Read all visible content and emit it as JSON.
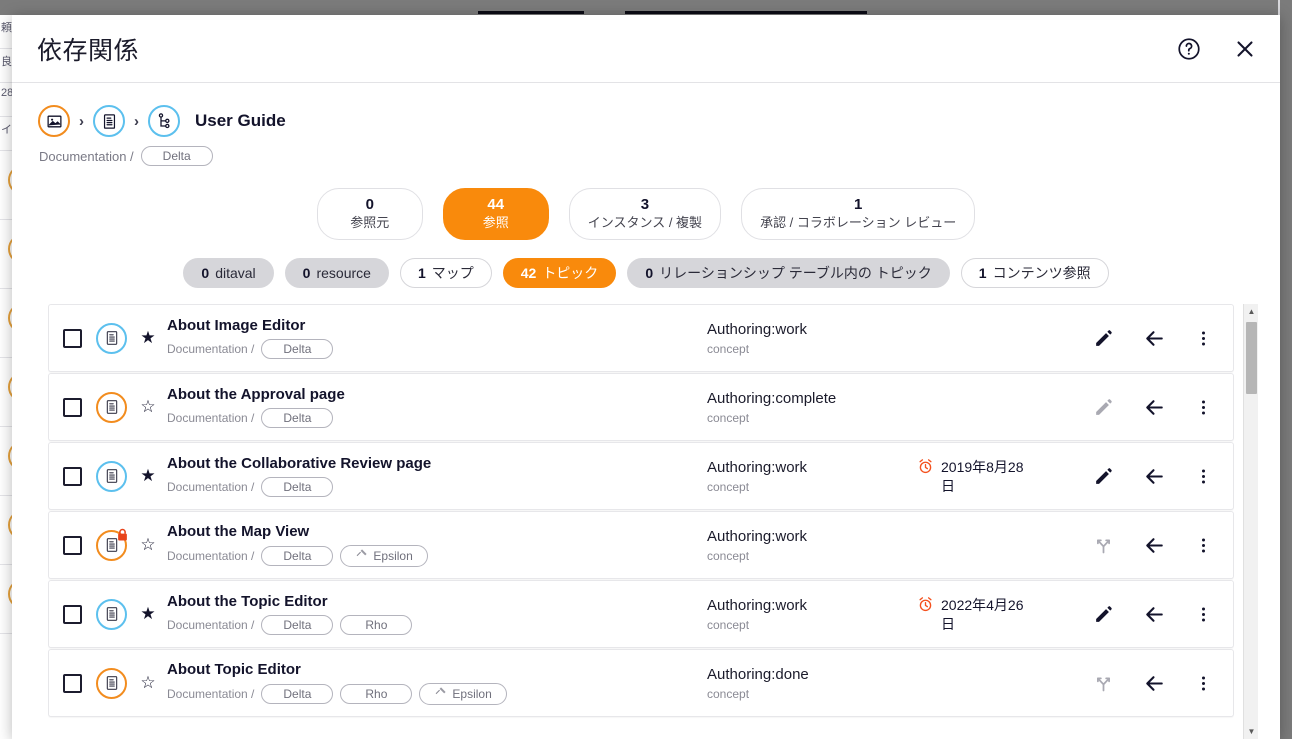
{
  "background": {
    "left_column_rows": [
      "頼",
      "良",
      "28",
      "イ",
      "",
      "",
      "",
      "",
      "",
      ""
    ]
  },
  "dialog": {
    "title": "依存関係",
    "help_icon": "help-circle-icon",
    "close_icon": "close-icon"
  },
  "breadcrumb": {
    "icons": [
      "image-icon",
      "document-icon",
      "dependency-graph-icon"
    ],
    "separator": "›",
    "name": "User Guide",
    "path_label": "Documentation /",
    "branch_chip": "Delta"
  },
  "stats": [
    {
      "num": "0",
      "label": "参照元",
      "active": false
    },
    {
      "num": "44",
      "label": "参照",
      "active": true
    },
    {
      "num": "3",
      "label": "インスタンス / 複製",
      "active": false
    },
    {
      "num": "1",
      "label": "承認 / コラボレーション レビュー",
      "active": false
    }
  ],
  "filters": [
    {
      "count": "0",
      "label": "ditaval",
      "style": "grey"
    },
    {
      "count": "0",
      "label": "resource",
      "style": "grey"
    },
    {
      "count": "1",
      "label": "マップ",
      "style": "plain"
    },
    {
      "count": "42",
      "label": "トピック",
      "style": "orange"
    },
    {
      "count": "0",
      "label": "リレーションシップ テーブル内の トピック",
      "style": "grey"
    },
    {
      "count": "1",
      "label": "コンテンツ参照",
      "style": "plain"
    }
  ],
  "list": {
    "path_label": "Documentation /",
    "rows": [
      {
        "title": "About Image Editor",
        "icon_color": "blue",
        "locked": false,
        "starred": true,
        "branches": [
          "Delta"
        ],
        "extra_branch": null,
        "status": "Authoring:work",
        "type": "concept",
        "date": "",
        "edit_icon": "pencil-icon",
        "edit_state": "active"
      },
      {
        "title": "About the Approval page",
        "icon_color": "orange",
        "locked": false,
        "starred": false,
        "branches": [
          "Delta"
        ],
        "extra_branch": null,
        "status": "Authoring:complete",
        "type": "concept",
        "date": "",
        "edit_icon": "pencil-icon",
        "edit_state": "disabled"
      },
      {
        "title": "About the Collaborative Review page",
        "icon_color": "blue",
        "locked": false,
        "starred": true,
        "branches": [
          "Delta"
        ],
        "extra_branch": null,
        "status": "Authoring:work",
        "type": "concept",
        "date": "2019年8月28日",
        "edit_icon": "pencil-icon",
        "edit_state": "active"
      },
      {
        "title": "About the Map View",
        "icon_color": "orange",
        "locked": true,
        "starred": false,
        "branches": [
          "Delta"
        ],
        "extra_branch": "Epsilon",
        "status": "Authoring:work",
        "type": "concept",
        "date": "",
        "edit_icon": "branch-icon",
        "edit_state": "disabled"
      },
      {
        "title": "About the Topic Editor",
        "icon_color": "blue",
        "locked": false,
        "starred": true,
        "branches": [
          "Delta",
          "Rho"
        ],
        "extra_branch": null,
        "status": "Authoring:work",
        "type": "concept",
        "date": "2022年4月26日",
        "edit_icon": "pencil-icon",
        "edit_state": "active"
      },
      {
        "title": "About Topic Editor",
        "icon_color": "orange",
        "locked": false,
        "starred": false,
        "branches": [
          "Delta",
          "Rho"
        ],
        "extra_branch": "Epsilon",
        "status": "Authoring:done",
        "type": "concept",
        "date": "",
        "edit_icon": "branch-icon",
        "edit_state": "disabled"
      }
    ],
    "row_action_icons": [
      "go-to-icon",
      "more-options-icon"
    ]
  },
  "colors": {
    "accent_orange": "#f98a0c",
    "icon_blue": "#5cc0ee",
    "icon_orange": "#f28c1e",
    "chip_grey": "#d6d6da",
    "text_dark": "#13132b",
    "text_muted": "#8a8a94",
    "alarm_red": "#f4511e"
  },
  "scrollbar": {
    "up_arrow": "triangle-up-icon",
    "down_arrow": "triangle-down-icon"
  }
}
